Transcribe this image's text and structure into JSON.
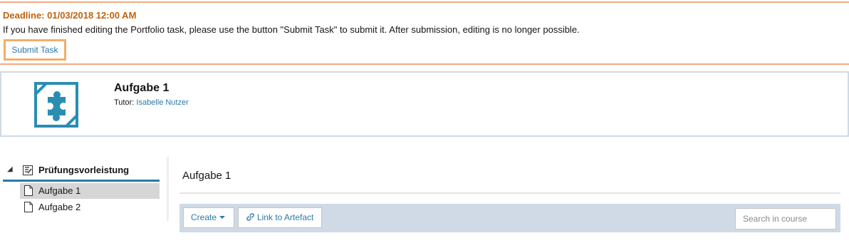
{
  "notice": {
    "deadline": "Deadline: 01/03/2018 12:00 AM",
    "message": "If you have finished editing the Portfolio task, please use the button \"Submit Task\" to submit it. After submission, editing is no longer possible.",
    "submit_label": "Submit Task"
  },
  "object": {
    "title": "Aufgabe 1",
    "tutor_label": "Tutor:",
    "tutor_name": "Isabelle Nutzer",
    "icon": "puzzle-icon"
  },
  "tree": {
    "root": {
      "label": "Prüfungsvorleistung",
      "icon": "portfolio-icon"
    },
    "items": [
      {
        "label": "Aufgabe 1",
        "icon": "document-icon",
        "active": true
      },
      {
        "label": "Aufgabe 2",
        "icon": "document-icon",
        "active": false
      }
    ]
  },
  "main": {
    "title": "Aufgabe 1",
    "toolbar": {
      "create_label": "Create",
      "link_label": "Link to Artefact",
      "search_placeholder": "Search in course"
    }
  },
  "colors": {
    "deadline": "#c4610c",
    "notice_border": "#f1aa82",
    "link": "#2a7aa6",
    "toolbar_bg": "#d0dae6",
    "icon_accent": "#2a8db2"
  }
}
